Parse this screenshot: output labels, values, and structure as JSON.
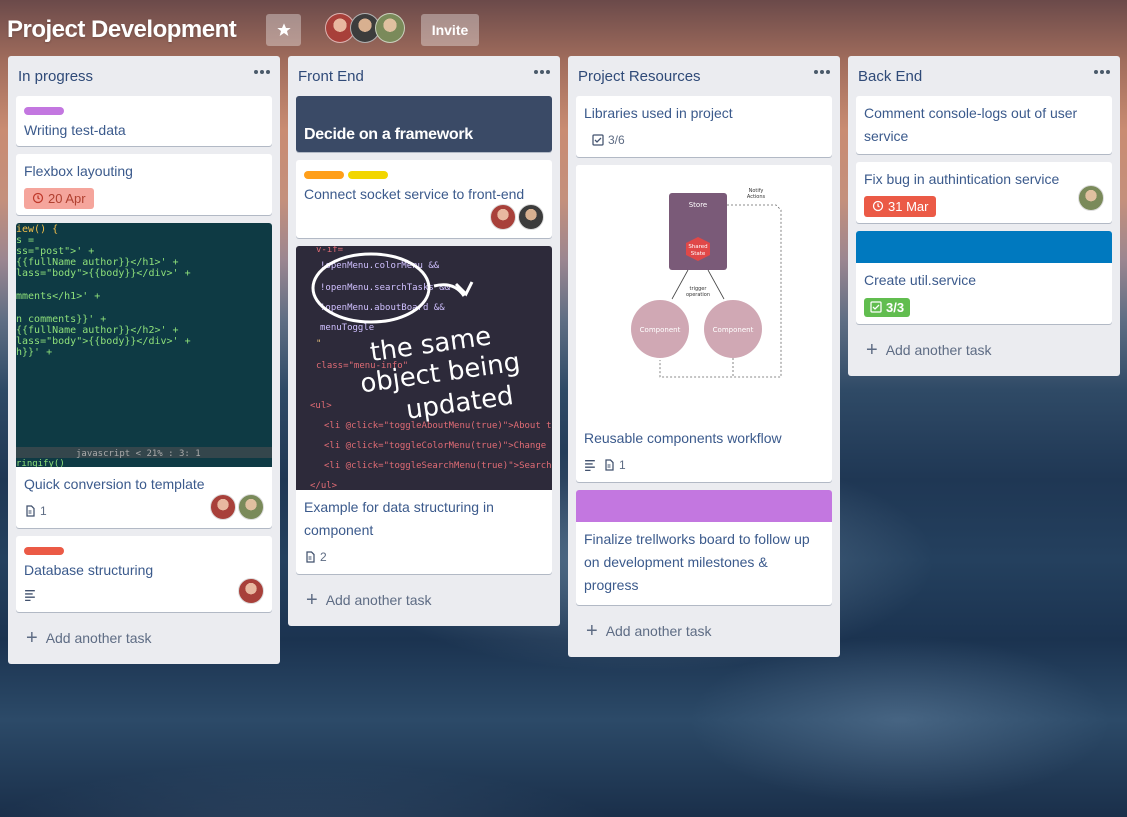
{
  "board": {
    "title": "Project Development",
    "invite_label": "Invite",
    "star_icon": "star-icon"
  },
  "add_task_label": "Add another task",
  "lists": [
    {
      "title": "In progress",
      "cards": [
        {
          "title": "Writing test-data",
          "labels": [
            "#c377e0"
          ]
        },
        {
          "title": "Flexbox layouting",
          "due": "20 Apr",
          "due_color": "#f5a59c"
        },
        {
          "title": "Quick conversion to template",
          "attachments": "1"
        },
        {
          "title": "Database structuring",
          "labels": [
            "#eb5a46"
          ]
        }
      ]
    },
    {
      "title": "Front End",
      "cards": [
        {
          "cover_title": "Decide on a framework"
        },
        {
          "title": "Connect socket service to front-end",
          "labels": [
            "#ff9f1a",
            "#f2d600"
          ]
        },
        {
          "title": "Example for data structuring in component",
          "attachments": "2",
          "image_text": "the same object being updated"
        }
      ]
    },
    {
      "title": "Project Resources",
      "cards": [
        {
          "title": "Libraries used in project",
          "checklist": "3/6"
        },
        {
          "title": "Reusable components workflow",
          "attachments": "1",
          "diagram": {
            "store": "Store",
            "shared": "Shared State",
            "component_a": "Component",
            "component_b": "Component",
            "notify": "Notify Actions",
            "trigger": "trigger operation"
          }
        },
        {
          "title": "Finalize trellworks board to follow up on development milestones & progress",
          "cover_color": "#c377e0"
        }
      ]
    },
    {
      "title": "Back End",
      "cards": [
        {
          "title": "Comment console-logs out of user service"
        },
        {
          "title": "Fix bug in authintication service",
          "due": "31 Mar",
          "due_color": "#eb5a46"
        },
        {
          "title": "Create util.service",
          "checklist": "3/3",
          "cover_color": "#0079bf",
          "checklist_color": "#61bd4f"
        }
      ]
    }
  ],
  "colors": {
    "accent": "#0079bf",
    "list_bg": "#ebecf0",
    "card_title": "#3b5a8c"
  }
}
